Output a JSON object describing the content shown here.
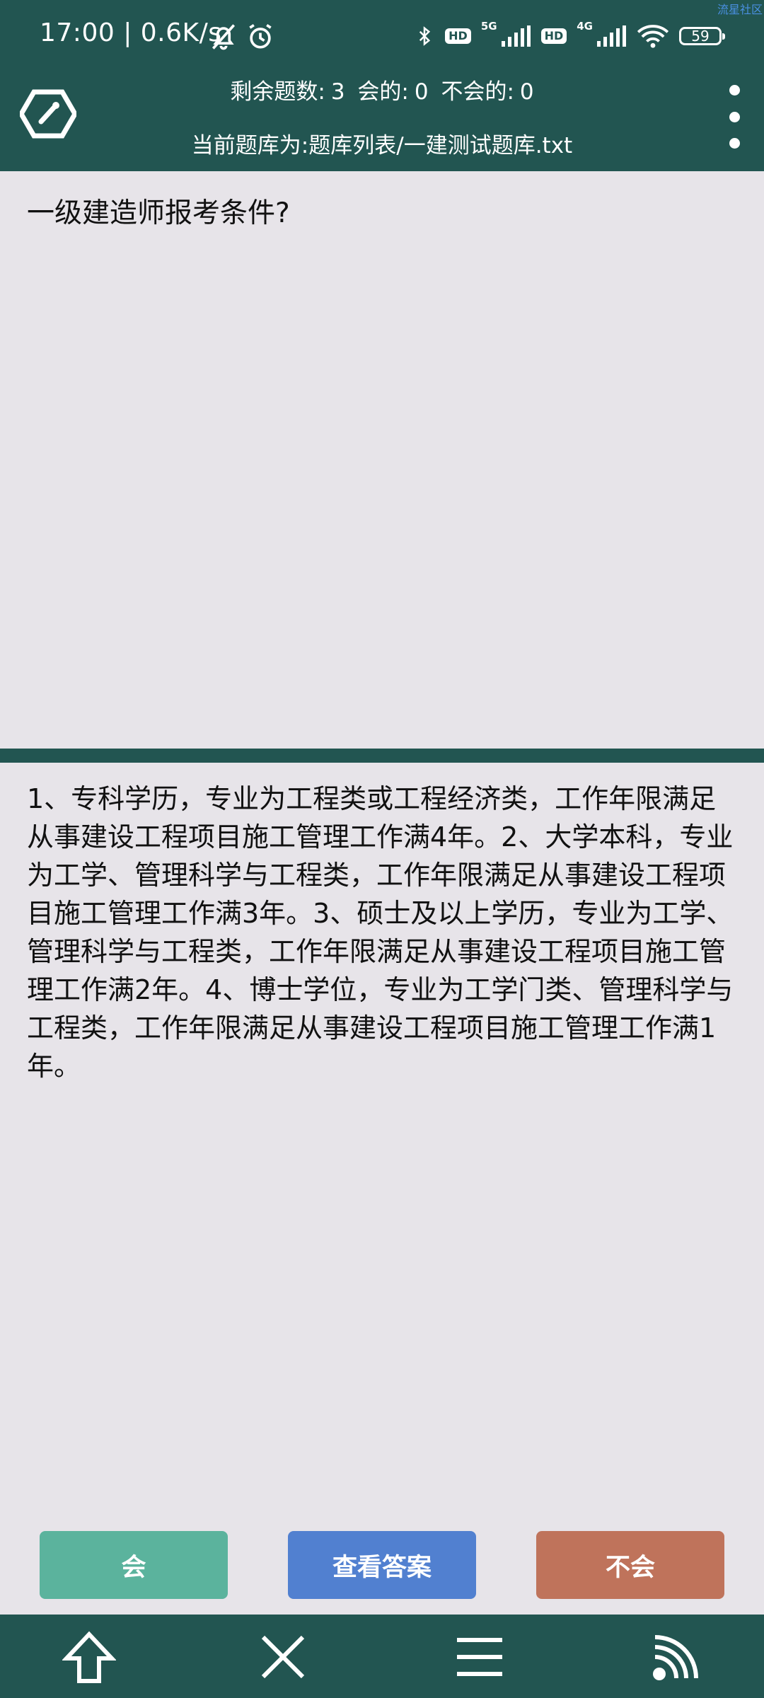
{
  "status_bar": {
    "time": "17:00",
    "speed": "0.6K/s",
    "network_5g": "5G",
    "network_4g": "4G",
    "hd_badge": "HD",
    "battery": "59",
    "watermark": "流星社区"
  },
  "header": {
    "remaining_label": "剩余题数:",
    "remaining_value": "3",
    "known_label": "会的:",
    "known_value": "0",
    "unknown_label": "不会的:",
    "unknown_value": "0",
    "bank_label": "当前题库为:",
    "bank_path": "题库列表/一建测试题库.txt"
  },
  "question": {
    "text": "一级建造师报考条件?"
  },
  "answer": {
    "text": "1、专科学历，专业为工程类或工程经济类，工作年限满足从事建设工程项目施工管理工作满4年。2、大学本科，专业为工学、管理科学与工程类，工作年限满足从事建设工程项目施工管理工作满3年。3、硕士及以上学历，专业为工学、管理科学与工程类，工作年限满足从事建设工程项目施工管理工作满2年。4、博士学位，专业为工学门类、管理科学与工程类，工作年限满足从事建设工程项目施工管理工作满1年。"
  },
  "buttons": {
    "know": "会",
    "view_answer": "查看答案",
    "dont_know": "不会"
  },
  "colors": {
    "primary": "#225551",
    "background": "#e7e4e9",
    "know": "#5bb39d",
    "view": "#5180d0",
    "dont_know": "#bf735b"
  },
  "icons": {
    "header_left": "wrench-hexagon-icon",
    "header_right": "more-vertical-icon",
    "nav": [
      "home-arrow-icon",
      "close-icon",
      "list-icon",
      "signal-icon"
    ]
  }
}
